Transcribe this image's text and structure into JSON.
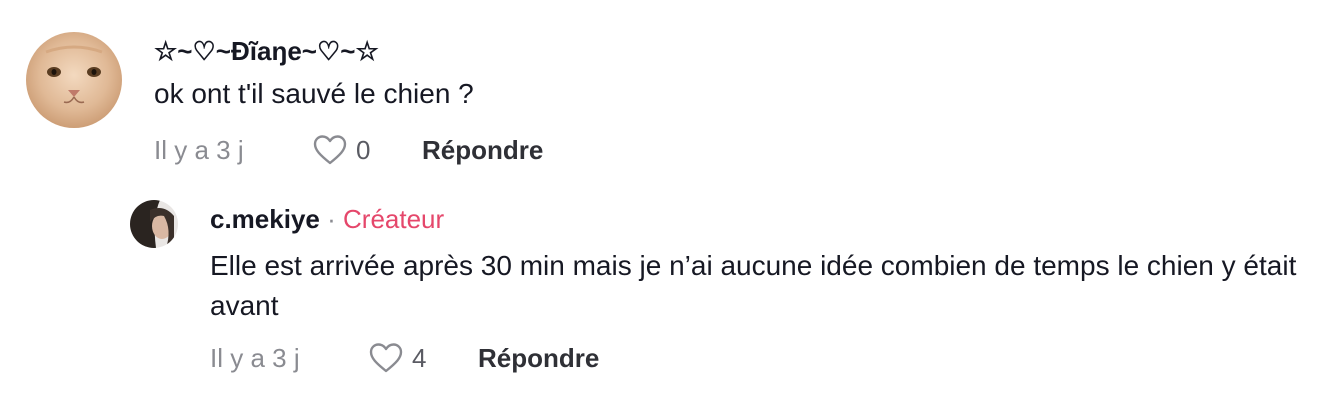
{
  "comments": [
    {
      "author": "☆~♡~Ðĩaŋe~♡~☆",
      "text": "ok ont t'il sauvé le chien ?",
      "time": "Il y a 3 j",
      "likes": "0",
      "reply_label": "Répondre"
    },
    {
      "author": "c.mekiye",
      "separator": "·",
      "badge": "Créateur",
      "text": "Elle est arrivée après 30 min mais je n’ai aucune idée combien de temps le chien y était avant",
      "time": "Il y a 3 j",
      "likes": "4",
      "reply_label": "Répondre"
    }
  ],
  "colors": {
    "creator_badge": "#e5476b",
    "muted": "#8a8b91",
    "text": "#161823"
  },
  "icons": {
    "like": "heart-outline-icon"
  }
}
